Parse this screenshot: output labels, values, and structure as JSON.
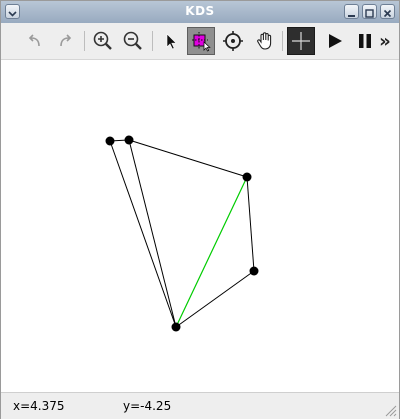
{
  "window": {
    "title": "KDS"
  },
  "toolbar": {
    "tools": [
      "undo",
      "redo",
      "zoom-in",
      "zoom-out",
      "select",
      "edit-point",
      "center",
      "pan",
      "crosshair",
      "play",
      "pause",
      "more"
    ],
    "overflow": "»"
  },
  "status": {
    "x_label": "x=4.375",
    "y_label": "y=-4.25"
  },
  "colors": {
    "edge": "#000000",
    "highlight": "#00cc00",
    "vertex": "#000000"
  }
}
